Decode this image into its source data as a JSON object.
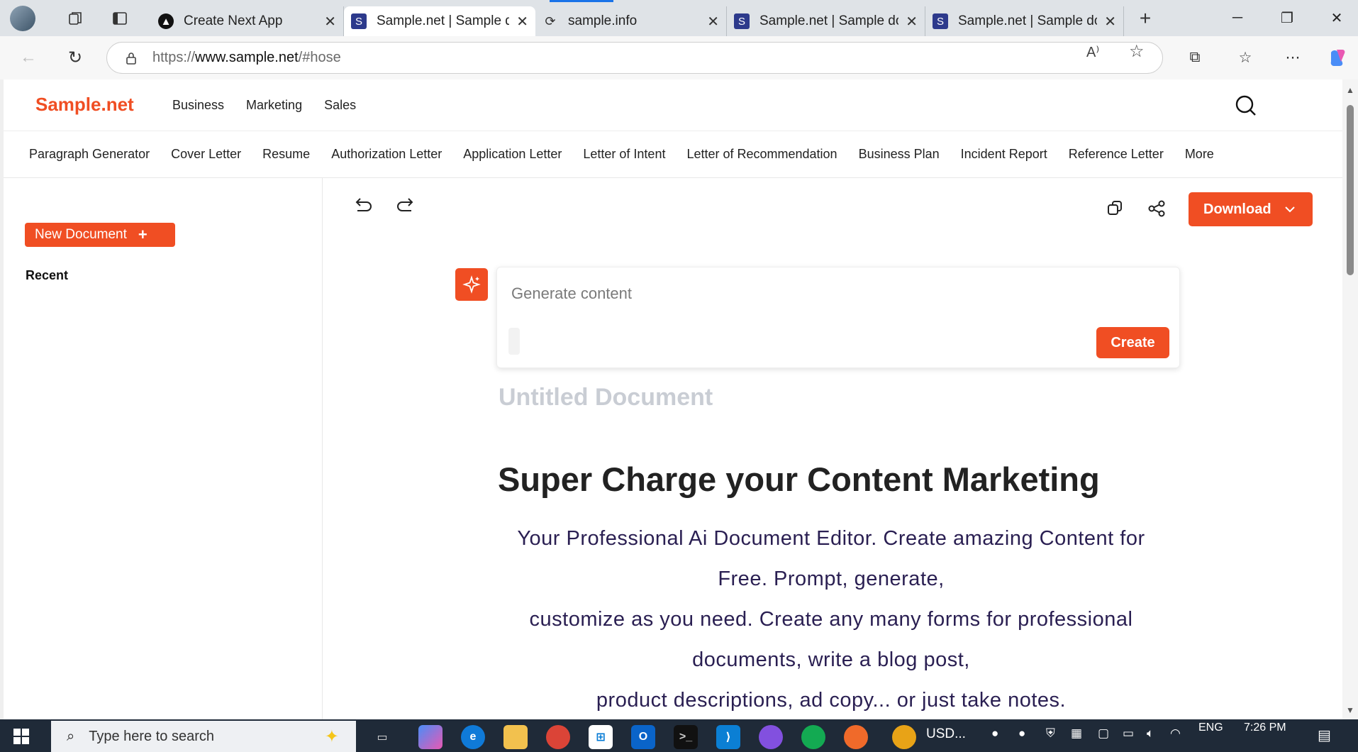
{
  "browser": {
    "tabs": [
      {
        "title": "Create Next App",
        "favicon": "triangle-icon",
        "active": false
      },
      {
        "title": "Sample.net | Sample do",
        "favicon": "S",
        "active": true
      },
      {
        "title": "sample.info",
        "favicon": "loading-icon",
        "active": false
      },
      {
        "title": "Sample.net | Sample do",
        "favicon": "S",
        "active": false
      },
      {
        "title": "Sample.net | Sample do",
        "favicon": "S",
        "active": false
      }
    ],
    "url_prefix": "https://",
    "url_domain": "www.sample.net",
    "url_path": "/#hose",
    "accent": "#1a73e8"
  },
  "site": {
    "logo": "Sample.net",
    "brand_color": "#f04e23",
    "topnav": [
      "Business",
      "Marketing",
      "Sales"
    ],
    "subnav": [
      "Paragraph Generator",
      "Cover Letter",
      "Resume",
      "Authorization Letter",
      "Application Letter",
      "Letter of Intent",
      "Letter of Recommendation",
      "Business Plan",
      "Incident Report",
      "Reference Letter",
      "More"
    ]
  },
  "sidebar": {
    "new_document": "New Document",
    "recent": "Recent"
  },
  "editor": {
    "download": "Download",
    "generate_placeholder": "Generate content",
    "create": "Create",
    "doc_title": "Untitled Document",
    "heading": "Super Charge your Content Marketing",
    "body_lines": [
      "Your Professional Ai Document Editor. Create amazing Content for Free. Prompt, generate,",
      "customize as you need. Create any many forms for professional documents, write a blog post,",
      "product descriptions, ad copy... or just take notes."
    ]
  },
  "taskbar": {
    "search_placeholder": "Type here to search",
    "usd_label": "USD...",
    "lang": "ENG",
    "time": "7:26 PM"
  }
}
